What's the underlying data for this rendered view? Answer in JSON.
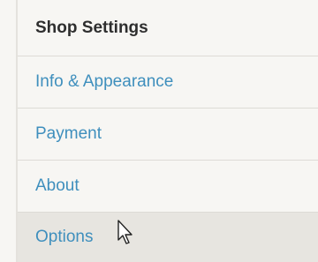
{
  "shop_settings": {
    "title": "Shop Settings",
    "items": [
      {
        "label": "Info & Appearance"
      },
      {
        "label": "Payment"
      },
      {
        "label": "About"
      },
      {
        "label": "Options"
      }
    ]
  },
  "colors": {
    "link": "#3f8fbd",
    "heading": "#2e2e2e",
    "background": "#f7f6f3",
    "active_background": "#e7e5e0",
    "divider": "#dddbd6"
  },
  "cursor": {
    "icon": "mouse-pointer-icon"
  }
}
